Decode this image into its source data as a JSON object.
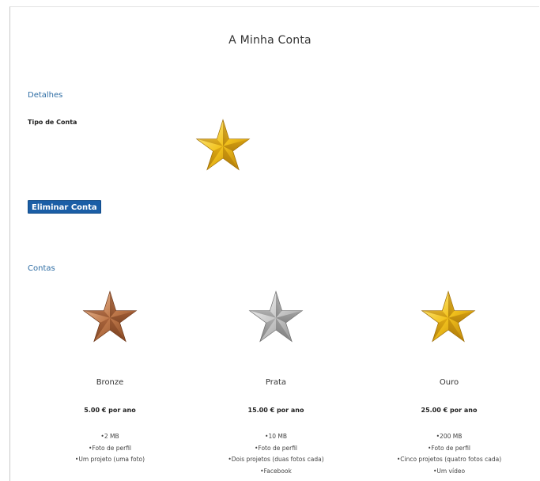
{
  "page": {
    "title": "A Minha Conta"
  },
  "details": {
    "heading": "Detalhes",
    "account_type_label": "Tipo de Conta",
    "current_tier_icon": "gold-star-icon"
  },
  "actions": {
    "delete_account_label": "Eliminar Conta"
  },
  "plans_section": {
    "heading": "Contas",
    "plans": [
      {
        "name": "Bronze",
        "icon": "bronze-star-icon",
        "price": "5.00 € por ano",
        "features": [
          "2 MB",
          "Foto de perfil",
          "Um projeto (uma foto)"
        ]
      },
      {
        "name": "Prata",
        "icon": "silver-star-icon",
        "price": "15.00 € por ano",
        "features": [
          "10 MB",
          "Foto de perfil",
          "Dois projetos (duas fotos cada)",
          "Facebook"
        ]
      },
      {
        "name": "Ouro",
        "icon": "gold-star-icon",
        "price": "25.00 € por ano",
        "features": [
          "200 MB",
          "Foto de perfil",
          "Cinco projetos (quatro fotos cada)",
          "Um vídeo"
        ]
      }
    ]
  },
  "colors": {
    "link_blue": "#2e6da4",
    "button_blue": "#1b5ea6",
    "gold": "#e8b51a",
    "silver": "#b5b5b5",
    "bronze": "#b8734a"
  }
}
